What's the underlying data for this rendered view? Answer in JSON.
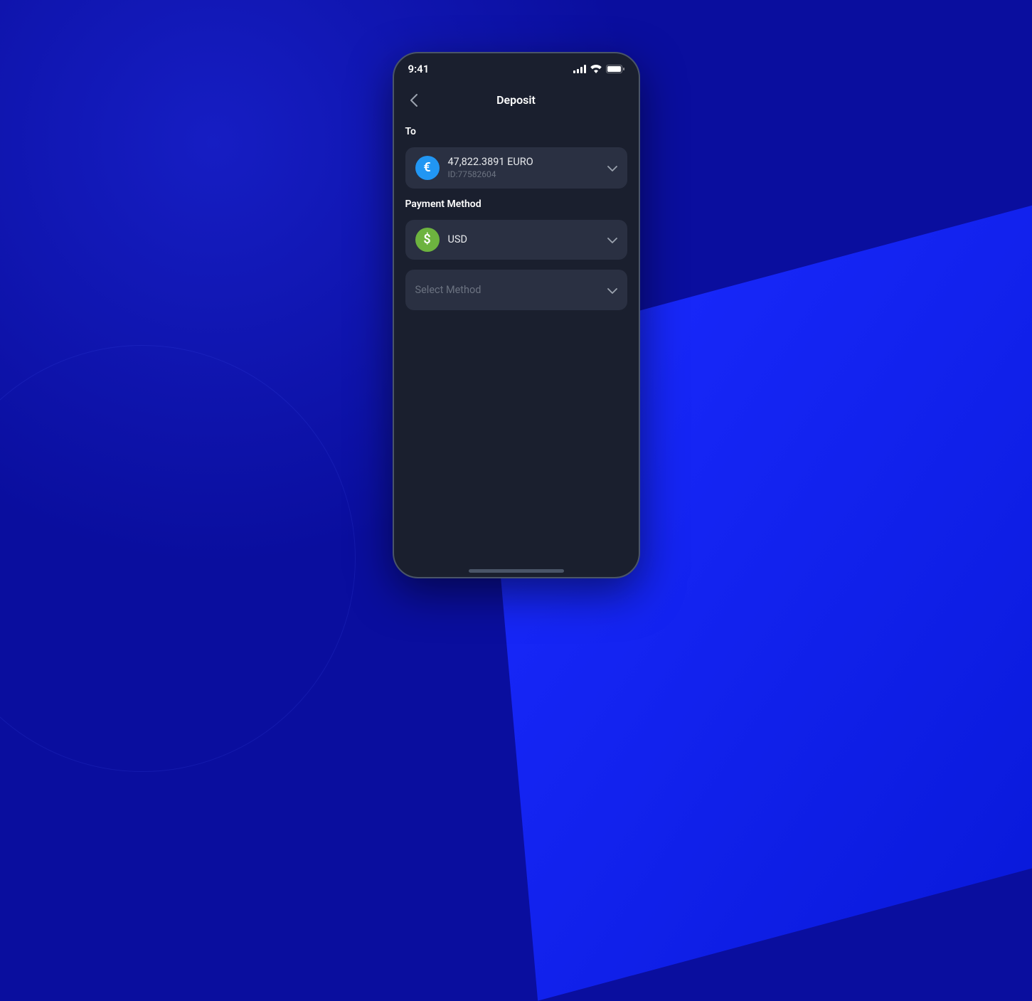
{
  "statusBar": {
    "time": "9:41"
  },
  "nav": {
    "title": "Deposit"
  },
  "sections": {
    "to": {
      "label": "To",
      "account": {
        "balance": "47,822.3891 EURO",
        "id": "ID:77582604",
        "iconGlyph": "€"
      }
    },
    "paymentMethod": {
      "label": "Payment Method",
      "currency": {
        "label": "USD",
        "iconGlyph": "$"
      },
      "method": {
        "placeholder": "Select Method"
      }
    }
  }
}
